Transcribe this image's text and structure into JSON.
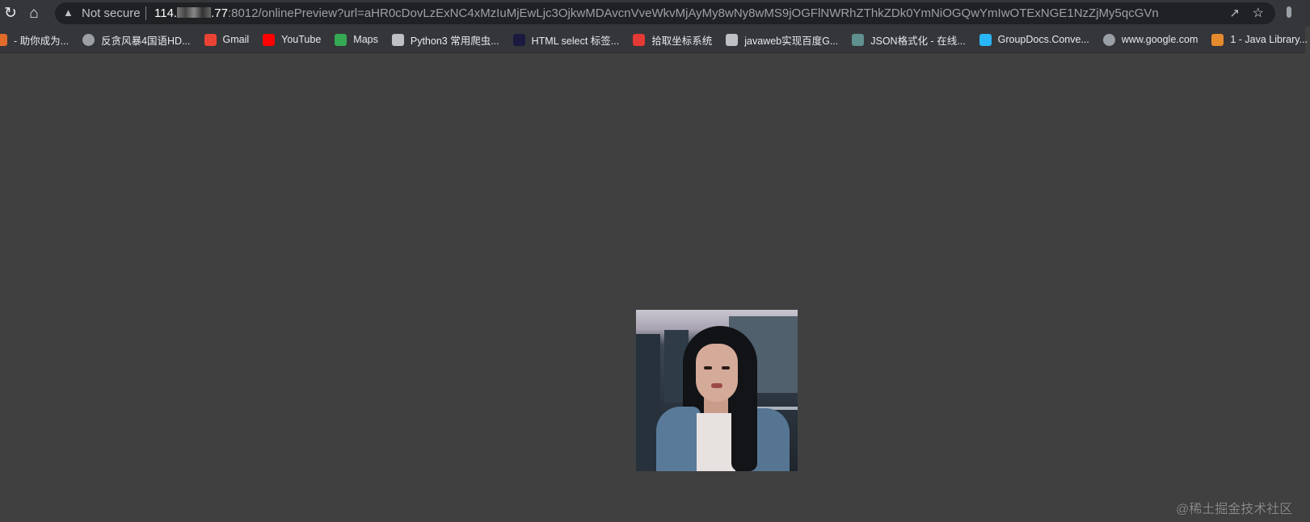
{
  "browser": {
    "security_label": "Not secure",
    "url_host_prefix": "114.",
    "url_host_suffix": ".77",
    "url_rest": ":8012/onlinePreview?url=aHR0cDovLzExNC4xMzIuMjEwLjc3OjkwMDAvcnVveWkvMjAyMy8wNy8wMS9jOGFlNWRhZThkZDk0YmNiOGQwYmIwOTExNGE1NzZjMy5qcGVn"
  },
  "bookmarks": [
    {
      "label": "- 助你成为...",
      "icon": "site-icon",
      "color": "#e06b2a"
    },
    {
      "label": "反贪风暴4国语HD...",
      "icon": "globe-icon",
      "color": "#9aa0a6"
    },
    {
      "label": "Gmail",
      "icon": "gmail-icon",
      "color": "#ea4335"
    },
    {
      "label": "YouTube",
      "icon": "youtube-icon",
      "color": "#ff0000"
    },
    {
      "label": "Maps",
      "icon": "maps-icon",
      "color": "#34a853"
    },
    {
      "label": "Python3 常用爬虫...",
      "icon": "site-icon",
      "color": "#bdc1c6"
    },
    {
      "label": "HTML select 标签...",
      "icon": "site-icon",
      "color": "#1a1a40"
    },
    {
      "label": "拾取坐标系统",
      "icon": "map-pin-icon",
      "color": "#e53935"
    },
    {
      "label": "javaweb实现百度G...",
      "icon": "site-icon",
      "color": "#bdc1c6"
    },
    {
      "label": "JSON格式化 - 在线...",
      "icon": "site-icon",
      "color": "#5f8f8f"
    },
    {
      "label": "GroupDocs.Conve...",
      "icon": "site-icon",
      "color": "#29b6f6"
    },
    {
      "label": "www.google.com",
      "icon": "globe-icon",
      "color": "#9aa0a6"
    },
    {
      "label": "1 - Java Library...",
      "icon": "site-icon",
      "color": "#e68a2e"
    }
  ],
  "watermark": "@稀土掘金技术社区"
}
